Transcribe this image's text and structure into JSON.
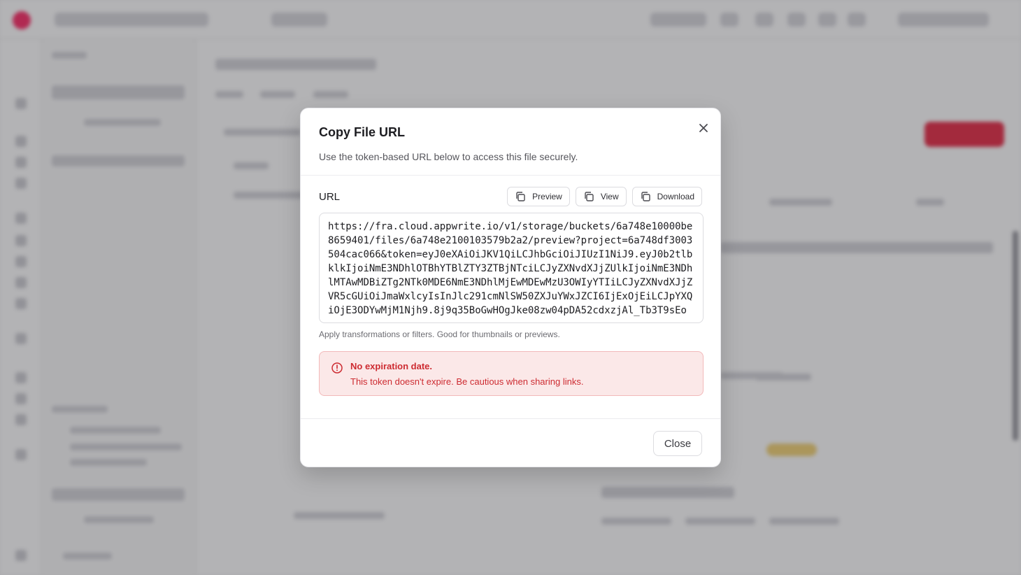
{
  "colors": {
    "brand": "#fd366e",
    "danger_text": "#cd2b31",
    "danger_bg": "#fbe8e8",
    "danger_border": "#f2b9ba"
  },
  "modal": {
    "title": "Copy File URL",
    "subtitle": "Use the token-based URL below to access this file securely.",
    "close_icon": "close-icon",
    "url_label": "URL",
    "actions": [
      {
        "label": "Preview",
        "icon": "copy-icon"
      },
      {
        "label": "View",
        "icon": "copy-icon"
      },
      {
        "label": "Download",
        "icon": "copy-icon"
      }
    ],
    "url_value": "https://fra.cloud.appwrite.io/v1/storage/buckets/6a748e10000be8659401/files/6a748e2100103579b2a2/preview?project=6a748df3003504cac066&token=eyJ0eXAiOiJKV1QiLCJhbGciOiJIUzI1NiJ9.eyJ0b2tlbklkIjoiNmE3NDhlOTBhYTBlZTY3ZTBjNTciLCJyZXNvdXJjZUlkIjoiNmE3NDhlMTAwMDBiZTg2NTk0MDE6NmE3NDhlMjEwMDEwMzU3OWIyYTIiLCJyZXNvdXJjZVR5cGUiOiJmaWxlcyIsInJlc291cmNlSW50ZXJuYWxJZCI6IjExOjEiLCJpYXQiOjE3ODYwMjM1Njh9.8j9q35BoGwHOgJke08zw04pDA52cdxzjAl_Tb3T9sEo",
    "url_hint": "Apply transformations or filters. Good for thumbnails or previews.",
    "alert": {
      "icon": "alert-circle-icon",
      "title": "No expiration date.",
      "body": "This token doesn't expire. Be cautious when sharing links."
    },
    "close_button": "Close"
  }
}
